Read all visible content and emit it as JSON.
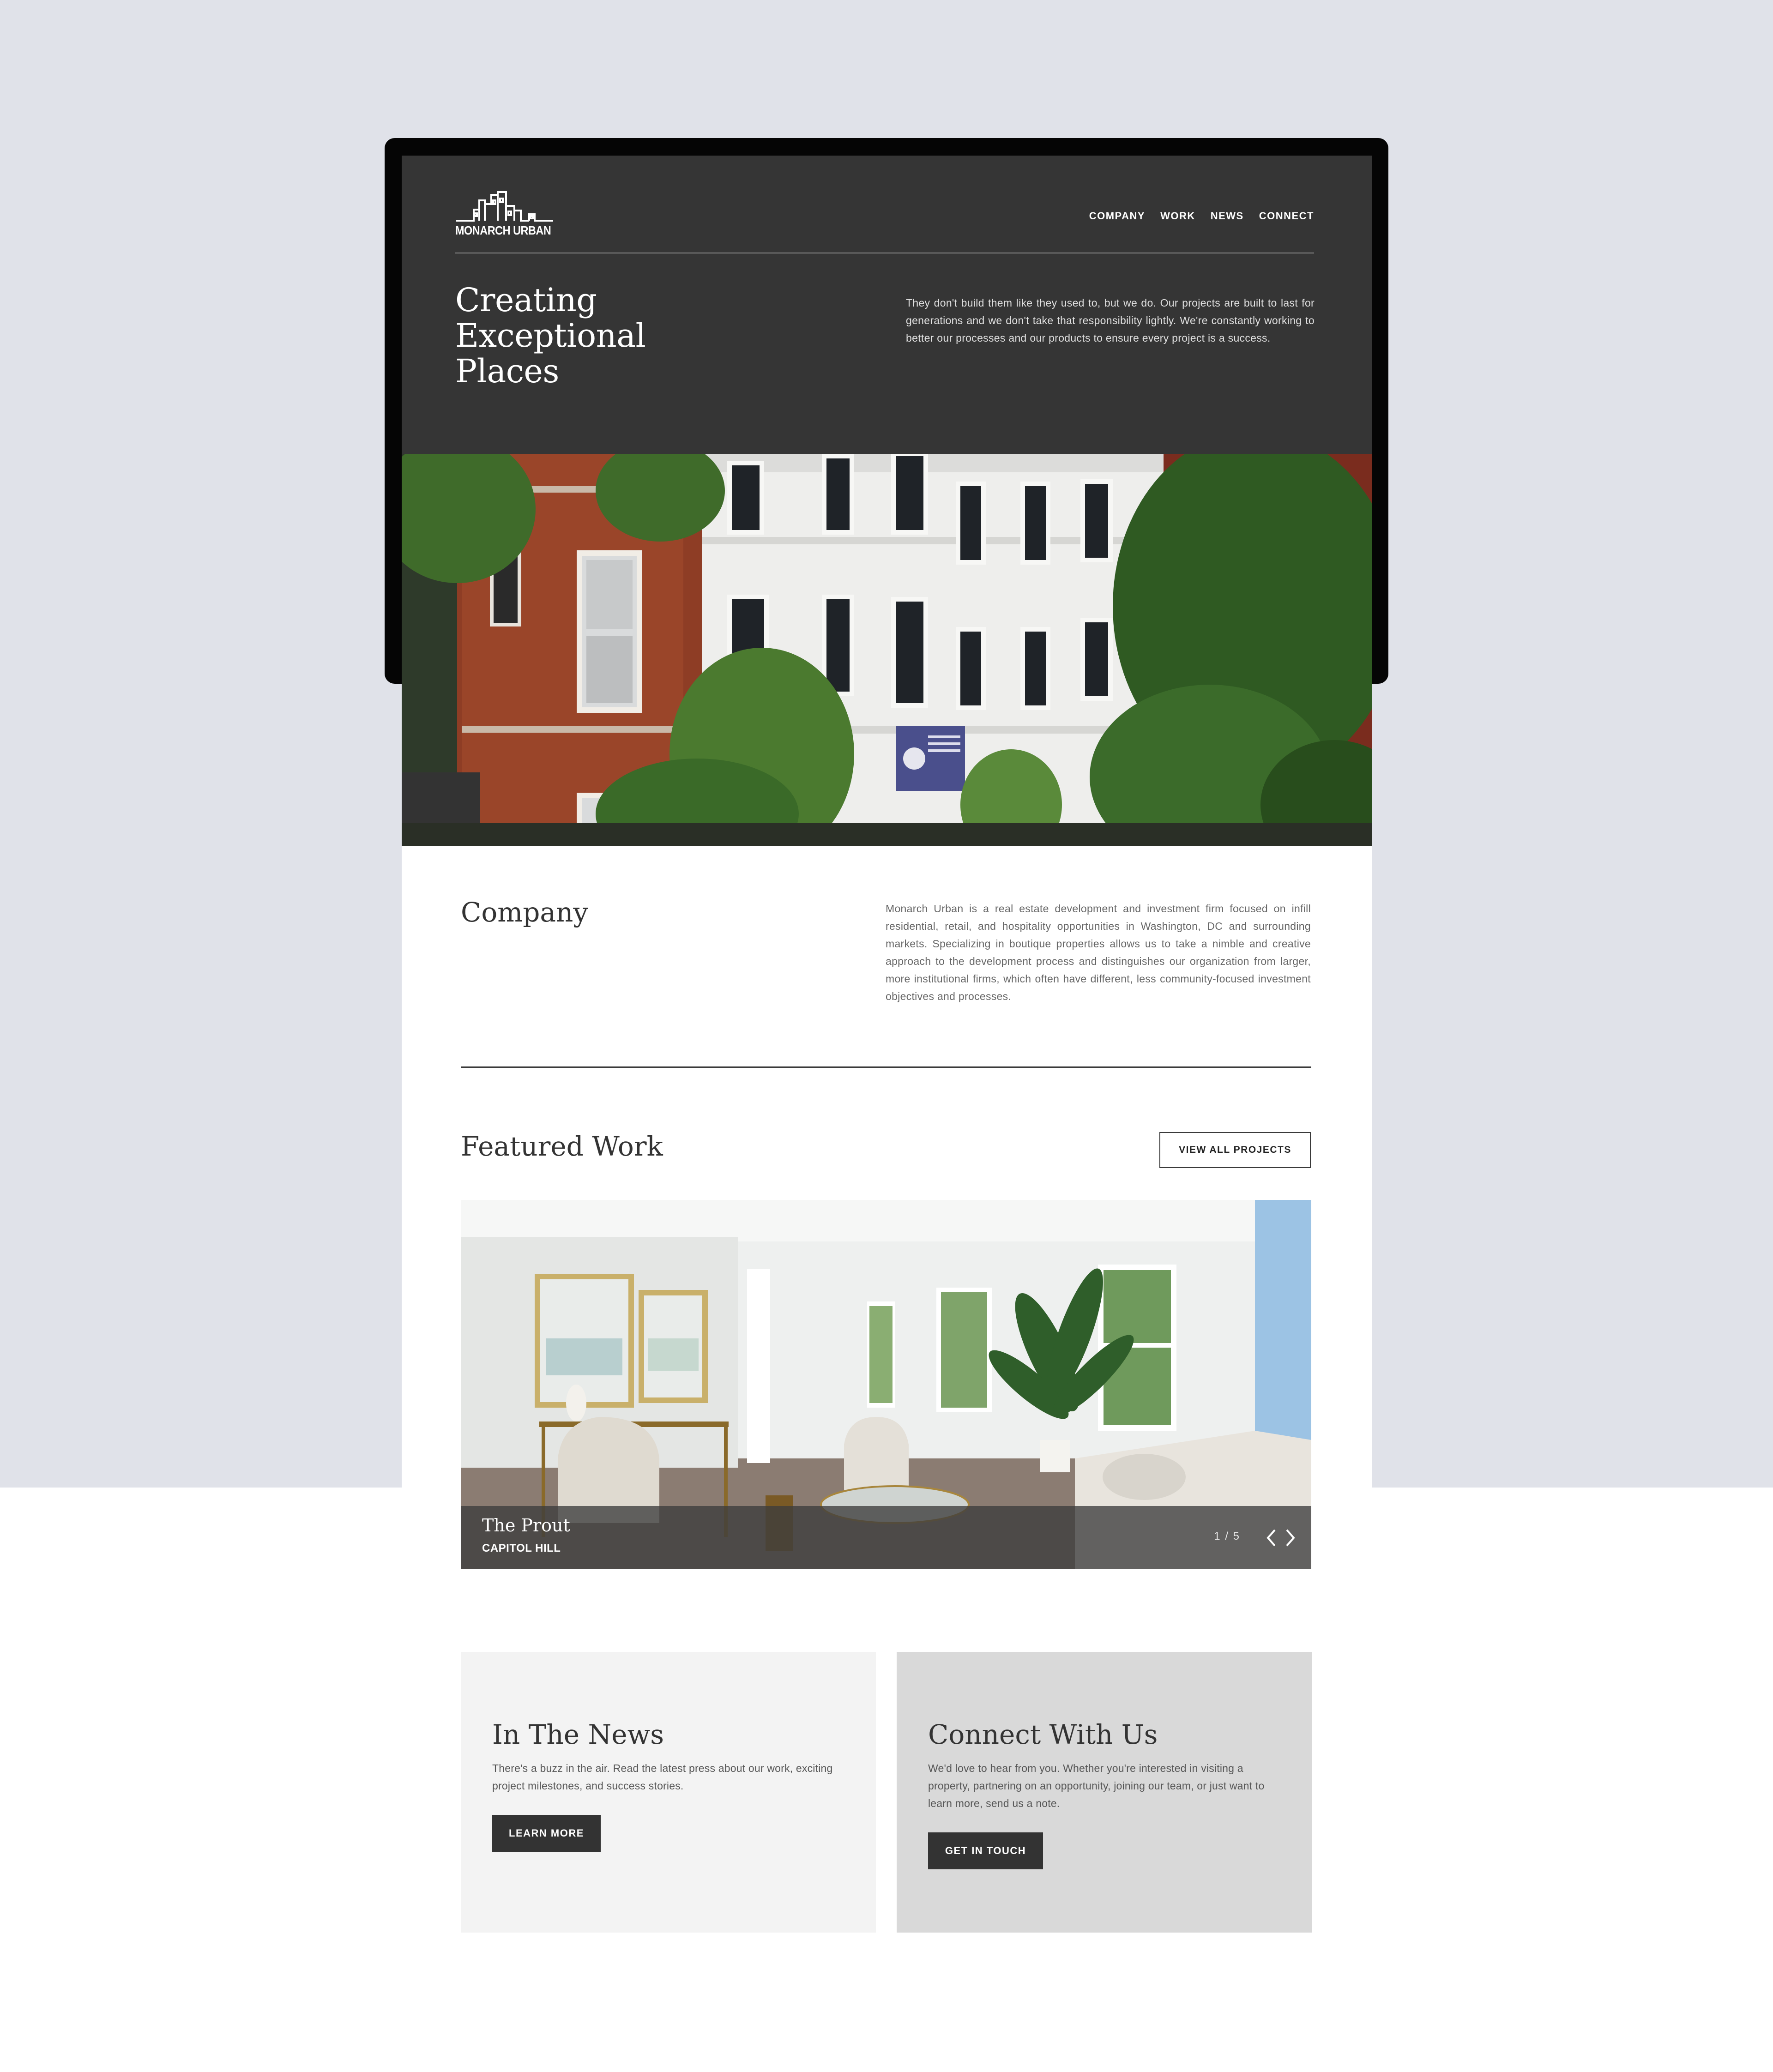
{
  "brand": {
    "logo_text": "MONARCH URBAN"
  },
  "nav": {
    "items": [
      {
        "label": "COMPANY"
      },
      {
        "label": "WORK"
      },
      {
        "label": "NEWS"
      },
      {
        "label": "CONNECT"
      }
    ]
  },
  "hero": {
    "title_lines": [
      "Creating",
      "Exceptional",
      "Places"
    ],
    "copy": "They don't build them like they used to, but we do. Our projects are built to last for generations and we don't take that responsibility lightly. We're constantly working to better our processes and our products to ensure every project is a success."
  },
  "company": {
    "title": "Company",
    "copy": "Monarch Urban is a real estate development and investment firm focused on infill residential, retail, and hospitality opportunities in Washington, DC and surrounding markets. Specializing in boutique properties allows us to take a nimble and creative approach to the development process and distinguishes our organization from larger, more institutional firms, which often have different, less community-focused investment objectives and processes."
  },
  "featured": {
    "title": "Featured Work",
    "view_all_label": "VIEW ALL PROJECTS",
    "slide": {
      "name": "The Prout",
      "location": "CAPITOL HILL",
      "counter": "1 / 5"
    }
  },
  "news": {
    "title": "In The News",
    "copy": "There's a buzz in the air. Read the latest press about our work, exciting project milestones, and success stories.",
    "button": "LEARN MORE"
  },
  "connect": {
    "title": "Connect With Us",
    "copy": "We'd love to hear from you. Whether you're interested in visiting a property, partnering on an opportunity, joining our team, or just want to learn more, send us a note.",
    "button": "GET IN TOUCH"
  },
  "colors": {
    "page_background": "#e0e2e9",
    "hero_background": "#353535",
    "button_dark": "#333333",
    "news_card": "#f3f3f3",
    "connect_card": "#d9d9d9"
  },
  "icons": [
    "monarch-urban-logo-icon",
    "chevron-left-icon",
    "chevron-right-icon"
  ]
}
